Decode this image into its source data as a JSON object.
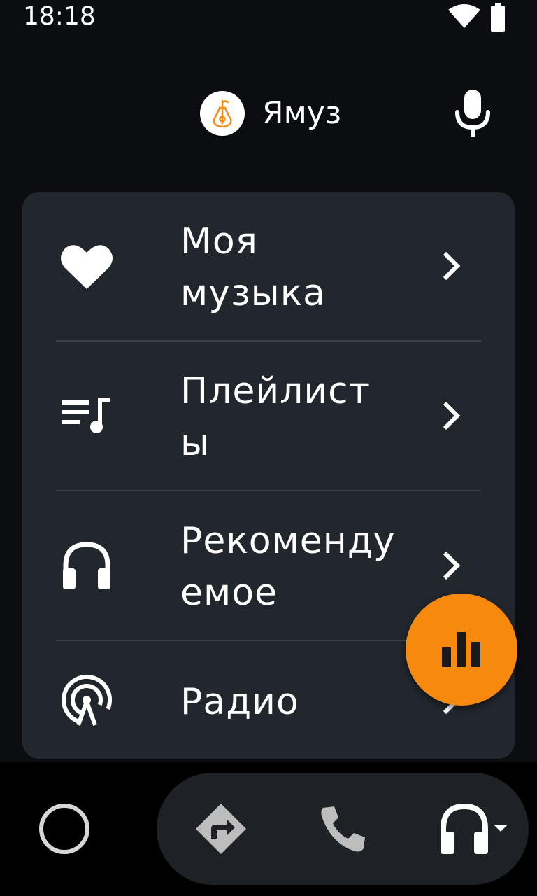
{
  "status_bar": {
    "time": "18:18",
    "wifi_icon": "wifi-icon",
    "battery_icon": "battery-icon"
  },
  "header": {
    "app_name": "Ямуз",
    "logo_icon": "pear-guitar-logo",
    "mic_icon": "microphone-icon"
  },
  "menu": {
    "items": [
      {
        "label": "Моя\nмузыка",
        "icon": "heart-icon"
      },
      {
        "label": "Плейлист\nы",
        "icon": "playlist-icon"
      },
      {
        "label": "Рекоменду\nемое",
        "icon": "headphones-icon"
      },
      {
        "label": "Радио",
        "icon": "radio-icon"
      }
    ]
  },
  "fab": {
    "icon": "equalizer-icon"
  },
  "bottom_nav": {
    "home_icon": "home-circle-icon",
    "navigation_icon": "directions-icon",
    "phone_icon": "phone-icon",
    "media_icon": "headphones-dropdown-icon"
  },
  "colors": {
    "background": "#0b0d10",
    "card": "#22272e",
    "accent": "#f7890e",
    "divider": "#3b4148",
    "nav_icon_inactive": "#bdbdbd"
  }
}
